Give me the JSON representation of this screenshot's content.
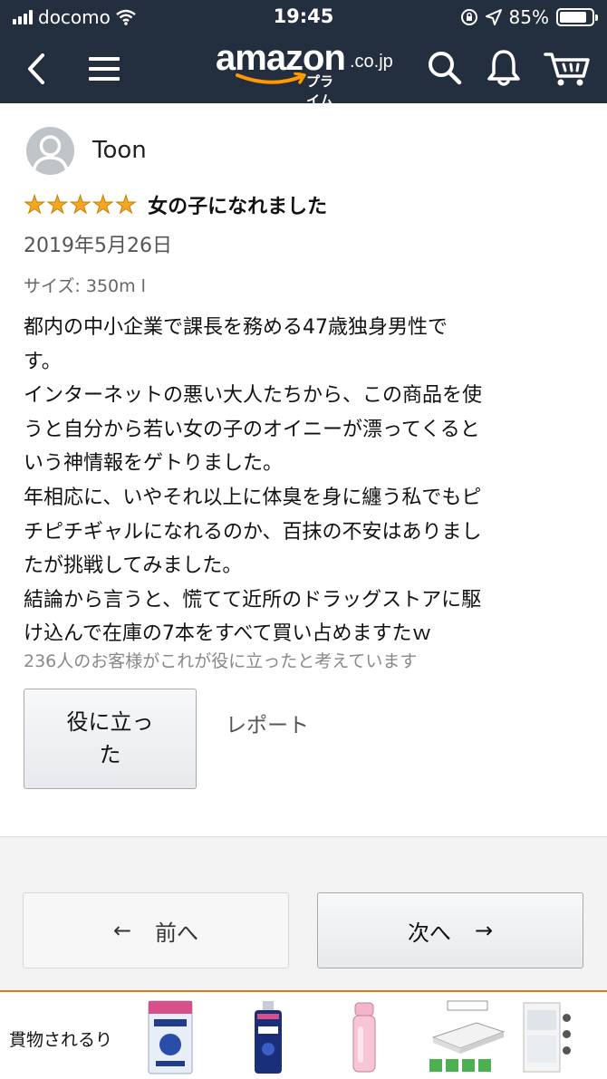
{
  "status_bar": {
    "carrier": "docomo",
    "time": "19:45",
    "battery": "85%",
    "battery_level": 0.85
  },
  "nav": {
    "logo_word": "amazon",
    "logo_domain": ".co.jp",
    "logo_prime": "プライム"
  },
  "review": {
    "author": "Toon",
    "rating": 5,
    "title": "女の子になれました",
    "date": "2019年5月26日",
    "variant": "サイズ: 350m l",
    "body_lines": [
      "都内の中小企業で課長を務める47歳独身男性で",
      "す。",
      "インターネットの悪い大人たちから、この商品を使",
      "うと自分から若い女の子のオイニーが漂ってくると",
      "いう神情報をゲトりました。",
      "年相応に、いやそれ以上に体臭を身に纏う私でもピ",
      "チピチギャルになれるのか、百抹の不安はありまし",
      "たが挑戦してみました。",
      "結論から言うと、慌てて近所のドラッグストアに駆",
      "け込んで在庫の7本をすべて買い占めますたｗ"
    ],
    "helpful_count": "236人のお客様がこれが役に立ったと考えています",
    "helpful_button_line1": "役に立っ",
    "helpful_button_line2": "た",
    "report_label": "レポート"
  },
  "pager": {
    "prev_arrow": "←",
    "prev_label": "前へ",
    "next_label": "次へ",
    "next_arrow": "→"
  },
  "bottom": {
    "label": "貫物されるり"
  },
  "colors": {
    "header_bg": "#232f3e",
    "star": "#f5a623",
    "accent_orange": "#e47911"
  }
}
